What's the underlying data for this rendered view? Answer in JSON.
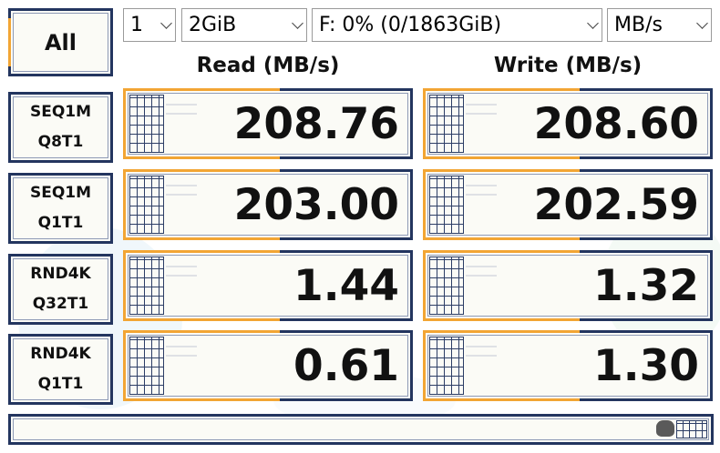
{
  "controls": {
    "all_label": "All",
    "count": "1",
    "size": "2GiB",
    "drive": "F: 0% (0/1863GiB)",
    "unit": "MB/s"
  },
  "headers": {
    "read": "Read (MB/s)",
    "write": "Write (MB/s)"
  },
  "tests": [
    {
      "line1": "SEQ1M",
      "line2": "Q8T1",
      "read": "208.76",
      "write": "208.60"
    },
    {
      "line1": "SEQ1M",
      "line2": "Q1T1",
      "read": "203.00",
      "write": "202.59"
    },
    {
      "line1": "RND4K",
      "line2": "Q32T1",
      "read": "1.44",
      "write": "1.32"
    },
    {
      "line1": "RND4K",
      "line2": "Q1T1",
      "read": "0.61",
      "write": "1.30"
    }
  ],
  "progress": {
    "fraction": 0
  },
  "colors": {
    "frame": "#23355f",
    "accent": "#f2a534",
    "panel": "#fbfbf6"
  },
  "icons": {
    "select_arrow": "chevron-down-icon",
    "lattice": "shoji-lattice-icon",
    "mascot": "mascot-icon"
  }
}
